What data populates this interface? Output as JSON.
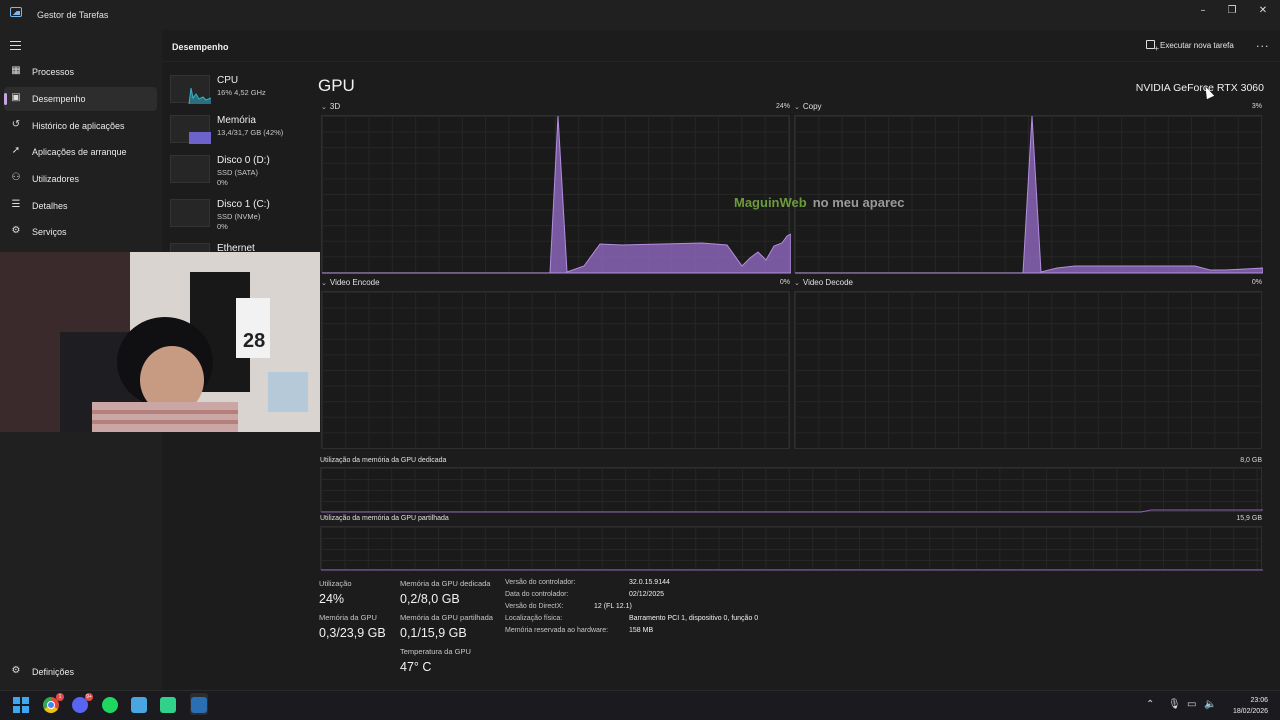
{
  "window": {
    "title": "Gestor de Tarefas"
  },
  "nav": {
    "items": [
      {
        "label": "Processos",
        "icon": "processes-icon"
      },
      {
        "label": "Desempenho",
        "icon": "performance-icon",
        "active": true
      },
      {
        "label": "Histórico de aplicações",
        "icon": "app-history-icon"
      },
      {
        "label": "Aplicações de arranque",
        "icon": "startup-apps-icon"
      },
      {
        "label": "Utilizadores",
        "icon": "users-icon"
      },
      {
        "label": "Detalhes",
        "icon": "details-icon"
      },
      {
        "label": "Serviços",
        "icon": "services-icon"
      }
    ],
    "settings_label": "Definições"
  },
  "header": {
    "title": "Desempenho",
    "run_task_label": "Executar nova tarefa",
    "more_label": "..."
  },
  "devices": [
    {
      "name": "CPU",
      "sub1": "16% 4,52 GHz",
      "sub2": ""
    },
    {
      "name": "Memória",
      "sub1": "13,4/31,7 GB (42%)",
      "sub2": ""
    },
    {
      "name": "Disco 0 (D:)",
      "sub1": "SSD (SATA)",
      "sub2": "0%"
    },
    {
      "name": "Disco 1 (C:)",
      "sub1": "SSD (NVMe)",
      "sub2": "0%"
    },
    {
      "name": "Ethernet",
      "sub1": "",
      "sub2": ""
    }
  ],
  "gpu": {
    "title": "GPU",
    "model": "NVIDIA GeForce RTX 3060",
    "graphs": [
      {
        "label": "3D",
        "value": "24%"
      },
      {
        "label": "Copy",
        "value": "3%"
      },
      {
        "label": "Video Encode",
        "value": "0%"
      },
      {
        "label": "Video Decode",
        "value": "0%"
      }
    ],
    "memory_graphs": [
      {
        "label": "Utilização da memória da GPU dedicada",
        "value": "8,0 GB"
      },
      {
        "label": "Utilização da memória da GPU partilhada",
        "value": "15,9 GB"
      }
    ]
  },
  "watermark": {
    "part1": "MaguinWeb",
    "part2": "no meu aparec"
  },
  "stats": {
    "utilization_label": "Utilização",
    "utilization_value": "24%",
    "dedicated_label": "Memória da GPU dedicada",
    "dedicated_value": "0,2/8,0 GB",
    "gpu_mem_label": "Memória da GPU",
    "gpu_mem_value": "0,3/23,9 GB",
    "shared_label": "Memória da GPU partilhada",
    "shared_value": "0,1/15,9 GB",
    "temp_label": "Temperatura da GPU",
    "temp_value": "47° C"
  },
  "info": [
    {
      "label": "Versão do controlador:",
      "value": "32.0.15.9144"
    },
    {
      "label": "Data do controlador:",
      "value": "02/12/2025"
    },
    {
      "label": "Versão do DirectX:",
      "value": "12 (FL 12.1)"
    },
    {
      "label": "Localização física:",
      "value": "Barramento PCI 1, dispositivo 0, função 0"
    },
    {
      "label": "Memória reservada ao hardware:",
      "value": "158 MB"
    }
  ],
  "taskbar": {
    "apps": [
      "windows-start-icon",
      "chrome-icon",
      "discord-icon",
      "spotify-icon",
      "notepad-icon",
      "app-green-icon",
      "task-manager-icon"
    ],
    "badges": {
      "chrome": "1",
      "discord": "9+"
    },
    "time": "23:06",
    "date": "18/02/2026"
  },
  "colors": {
    "accent": "#c7a3e6",
    "graph_fill": "#8a64b6",
    "background": "#1c1c1c"
  }
}
